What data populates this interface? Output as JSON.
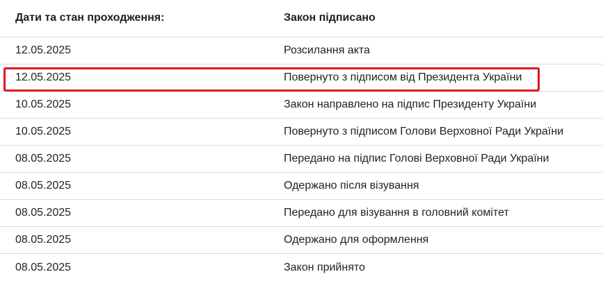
{
  "header": {
    "date_label": "Дати та стан проходження:",
    "status_label": "Закон підписано"
  },
  "rows": [
    {
      "date": "12.05.2025",
      "event": "Розсилання акта"
    },
    {
      "date": "12.05.2025",
      "event": "Повернуто з підписом від Президента України",
      "highlighted": true
    },
    {
      "date": "10.05.2025",
      "event": "Закон направлено на підпис Президенту України"
    },
    {
      "date": "10.05.2025",
      "event": "Повернуто з підписом Голови Верховної Ради України"
    },
    {
      "date": "08.05.2025",
      "event": "Передано на підпис Голові Верховної Ради України"
    },
    {
      "date": "08.05.2025",
      "event": "Одержано після візування"
    },
    {
      "date": "08.05.2025",
      "event": "Передано для візування в головний комітет"
    },
    {
      "date": "08.05.2025",
      "event": "Одержано для оформлення"
    },
    {
      "date": "08.05.2025",
      "event": "Закон прийнято"
    }
  ],
  "colors": {
    "highlight_border": "#e0171e",
    "divider": "#dcdcdc",
    "text": "#222222"
  }
}
